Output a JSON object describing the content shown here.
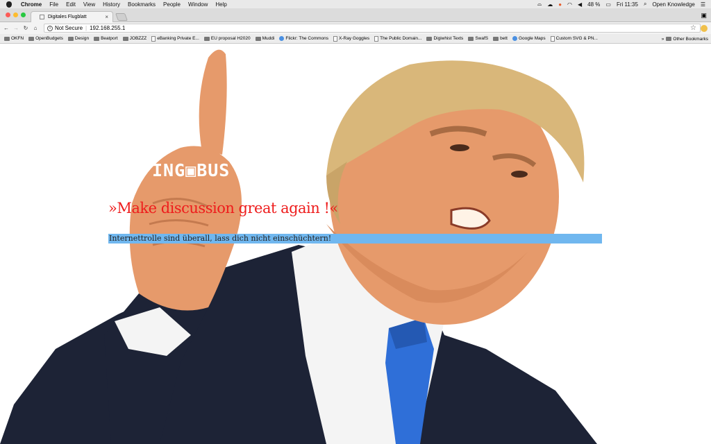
{
  "menubar": {
    "app": "Chrome",
    "items": [
      "File",
      "Edit",
      "View",
      "History",
      "Bookmarks",
      "People",
      "Window",
      "Help"
    ],
    "battery": "48 %",
    "clock": "Fri 11:35",
    "user": "Open Knowledge"
  },
  "tab": {
    "title": "Digitales Flugblatt",
    "close": "×"
  },
  "toolbar": {
    "security": "Not Secure",
    "url": "192.168.255.1",
    "back": "←",
    "forward": "→",
    "reload": "↻",
    "home": "⌂",
    "star": "☆"
  },
  "bookmarks": [
    {
      "label": "OKFN",
      "icon": "folder-icon"
    },
    {
      "label": "OpenBudgets",
      "icon": "folder-icon"
    },
    {
      "label": "Design",
      "icon": "folder-icon"
    },
    {
      "label": "Beatport",
      "icon": "folder-icon"
    },
    {
      "label": "JOBZZZ",
      "icon": "folder-icon"
    },
    {
      "label": "eBanking Private E...",
      "icon": "page-icon"
    },
    {
      "label": "EU proposal H2020",
      "icon": "folder-icon"
    },
    {
      "label": "Muddi",
      "icon": "folder-icon"
    },
    {
      "label": "Flickr: The Commons",
      "icon": "flickr-icon"
    },
    {
      "label": "X-Ray Goggles",
      "icon": "page-icon"
    },
    {
      "label": "The Public Domain...",
      "icon": "page-icon"
    },
    {
      "label": "Digiwhist Texts",
      "icon": "folder-icon"
    },
    {
      "label": "SwafS",
      "icon": "folder-icon"
    },
    {
      "label": "bett",
      "icon": "folder-icon"
    },
    {
      "label": "Google Maps",
      "icon": "maps-icon"
    },
    {
      "label": "Custom SVG & PN...",
      "icon": "page-icon"
    }
  ],
  "other_bookmarks": "Other Bookmarks",
  "overflow": "»",
  "page": {
    "logo": "ING▣BUS",
    "headline": "»Make discussion great again !«",
    "subline": "Internettrolle sind überall, lass dich nicht einschüchtern!"
  },
  "colors": {
    "headline": "#ee1c1c",
    "highlight": "#70b7ef",
    "suit": "#1d2336",
    "tie": "#2f6fd8"
  }
}
